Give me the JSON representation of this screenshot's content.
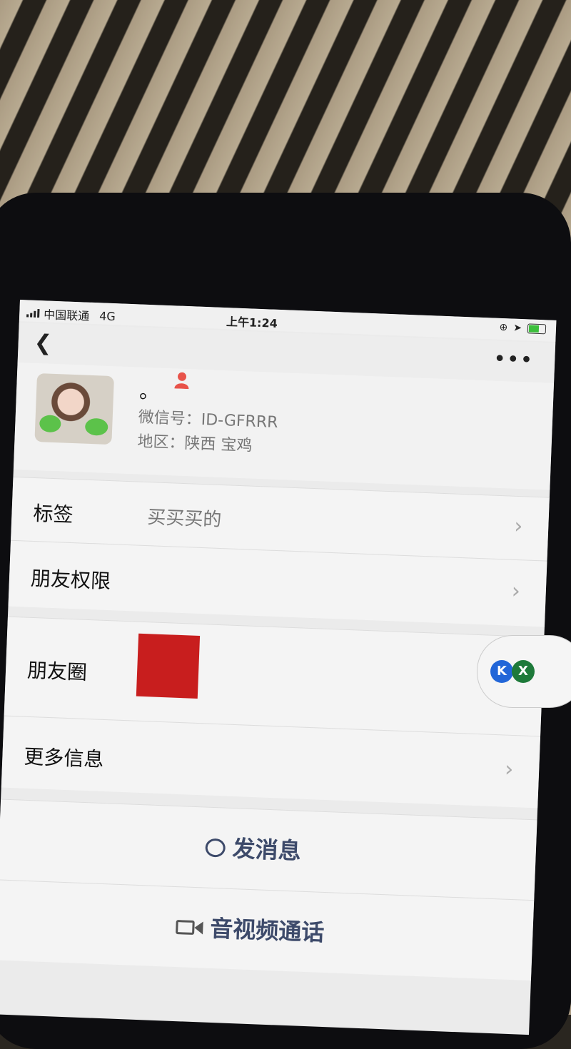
{
  "status_bar": {
    "carrier": "中国联通",
    "network": "4G",
    "time": "上午1:24"
  },
  "navbar": {
    "back_icon": "chevron-left-icon",
    "more_icon": "more-dots-icon"
  },
  "profile": {
    "nickname": "。",
    "wechat_id": "微信号：ID-GFRRR",
    "region": "地区：陕西 宝鸡",
    "gender_icon": "female-user-icon",
    "gender_color": "#e8534a"
  },
  "rows": {
    "tags_label": "标签",
    "tags_value": "买买买的",
    "permissions_label": "朋友权限",
    "moments_label": "朋友圈",
    "more_info_label": "更多信息"
  },
  "actions": {
    "message_label": "发消息",
    "call_label": "音视频通话"
  },
  "floating": {
    "k_label": "K",
    "x_label": "X"
  },
  "colors": {
    "action_text": "#3d4a6a",
    "background": "#ebebeb"
  }
}
